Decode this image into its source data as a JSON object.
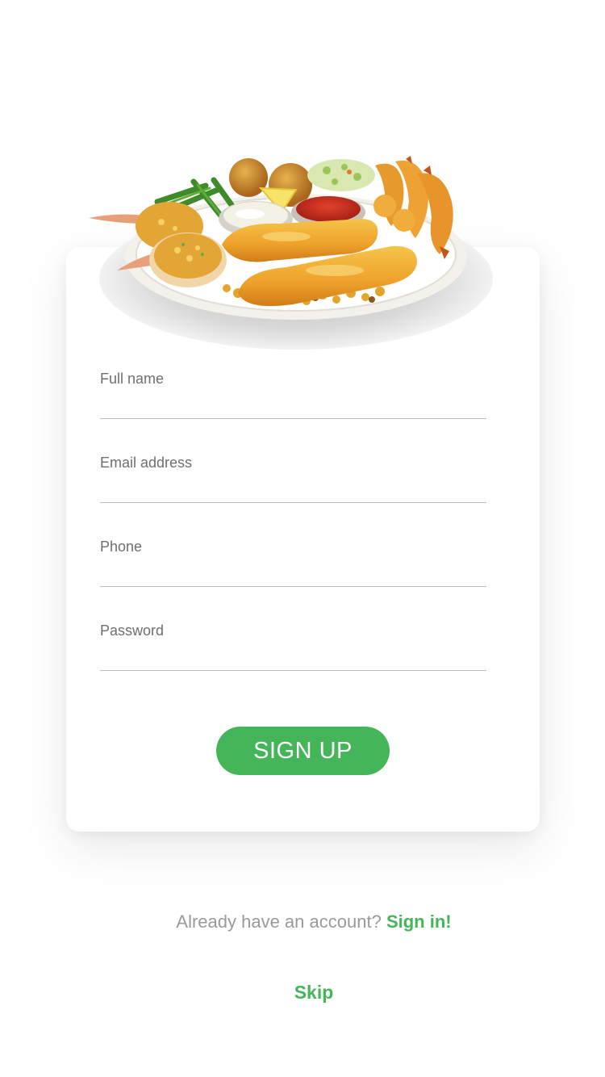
{
  "form": {
    "fields": [
      {
        "label": "Full name",
        "value": ""
      },
      {
        "label": "Email address",
        "value": ""
      },
      {
        "label": "Phone",
        "value": ""
      },
      {
        "label": "Password",
        "value": ""
      }
    ],
    "signup_label": "SIGN UP"
  },
  "footer": {
    "signin_prompt": "Already have an account?",
    "signin_link": "Sign in!",
    "skip_label": "Skip"
  },
  "image": {
    "subject": "seafood-platter-icon"
  },
  "colors": {
    "accent": "#45b55a",
    "label": "#6f6f6f",
    "muted": "#9a9a9a",
    "underline": "#bdbdbd"
  }
}
